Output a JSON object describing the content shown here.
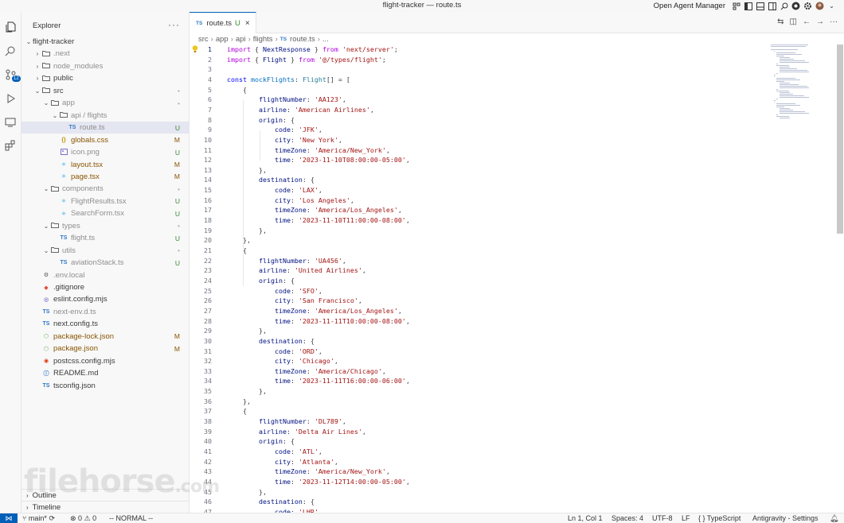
{
  "window": {
    "title": "flight-tracker — route.ts",
    "agent_manager": "Open Agent Manager"
  },
  "activity_bar": {
    "items": [
      "explorer-icon",
      "search-icon",
      "source-control-icon",
      "run-debug-icon",
      "remote-explorer-icon",
      "extensions-icon"
    ],
    "scm_badge": "12"
  },
  "sidebar": {
    "header": "Explorer",
    "more": "···",
    "tree": [
      {
        "label": "flight-tracker",
        "depth": 0,
        "chev": "⌄",
        "icon": "",
        "status": "",
        "cls": ""
      },
      {
        "label": ".next",
        "depth": 1,
        "chev": "›",
        "icon": "folder",
        "status": "",
        "cls": "c-ign"
      },
      {
        "label": "node_modules",
        "depth": 1,
        "chev": "›",
        "icon": "folder",
        "status": "",
        "cls": "c-ign"
      },
      {
        "label": "public",
        "depth": 1,
        "chev": "›",
        "icon": "folder",
        "status": "",
        "cls": ""
      },
      {
        "label": "src",
        "depth": 1,
        "chev": "⌄",
        "icon": "folder",
        "status": "•",
        "cls": ""
      },
      {
        "label": "app",
        "depth": 2,
        "chev": "⌄",
        "icon": "folder",
        "status": "•",
        "cls": "c-ign"
      },
      {
        "label": "api / flights",
        "depth": 3,
        "chev": "⌄",
        "icon": "folder",
        "status": "",
        "cls": "c-ign"
      },
      {
        "label": "route.ts",
        "depth": 4,
        "chev": "",
        "icon": "TS",
        "status": "U",
        "cls": "c-ign",
        "selected": true
      },
      {
        "label": "globals.css",
        "depth": 3,
        "chev": "",
        "icon": "{}",
        "status": "M",
        "cls": "c-mod"
      },
      {
        "label": "icon.png",
        "depth": 3,
        "chev": "",
        "icon": "img",
        "status": "U",
        "cls": "c-ign"
      },
      {
        "label": "layout.tsx",
        "depth": 3,
        "chev": "",
        "icon": "⚛",
        "status": "M",
        "cls": "c-mod"
      },
      {
        "label": "page.tsx",
        "depth": 3,
        "chev": "",
        "icon": "⚛",
        "status": "M",
        "cls": "c-mod"
      },
      {
        "label": "components",
        "depth": 2,
        "chev": "⌄",
        "icon": "folder",
        "status": "•",
        "cls": "c-ign"
      },
      {
        "label": "FlightResults.tsx",
        "depth": 3,
        "chev": "",
        "icon": "⚛",
        "status": "U",
        "cls": "c-ign"
      },
      {
        "label": "SearchForm.tsx",
        "depth": 3,
        "chev": "",
        "icon": "⚛",
        "status": "U",
        "cls": "c-ign"
      },
      {
        "label": "types",
        "depth": 2,
        "chev": "⌄",
        "icon": "folder",
        "status": "•",
        "cls": "c-ign"
      },
      {
        "label": "flight.ts",
        "depth": 3,
        "chev": "",
        "icon": "TS",
        "status": "U",
        "cls": "c-ign"
      },
      {
        "label": "utils",
        "depth": 2,
        "chev": "⌄",
        "icon": "folder",
        "status": "•",
        "cls": "c-ign"
      },
      {
        "label": "aviationStack.ts",
        "depth": 3,
        "chev": "",
        "icon": "TS",
        "status": "U",
        "cls": "c-ign"
      },
      {
        "label": ".env.local",
        "depth": 1,
        "chev": "",
        "icon": "⚙",
        "status": "",
        "cls": "c-ign"
      },
      {
        "label": ".gitignore",
        "depth": 1,
        "chev": "",
        "icon": "◆",
        "status": "",
        "cls": ""
      },
      {
        "label": "eslint.config.mjs",
        "depth": 1,
        "chev": "",
        "icon": "◎",
        "status": "",
        "cls": ""
      },
      {
        "label": "next-env.d.ts",
        "depth": 1,
        "chev": "",
        "icon": "TS",
        "status": "",
        "cls": "c-ign"
      },
      {
        "label": "next.config.ts",
        "depth": 1,
        "chev": "",
        "icon": "TS",
        "status": "",
        "cls": ""
      },
      {
        "label": "package-lock.json",
        "depth": 1,
        "chev": "",
        "icon": "⬡",
        "status": "M",
        "cls": "c-mod"
      },
      {
        "label": "package.json",
        "depth": 1,
        "chev": "",
        "icon": "⬡",
        "status": "M",
        "cls": "c-mod"
      },
      {
        "label": "postcss.config.mjs",
        "depth": 1,
        "chev": "",
        "icon": "◉",
        "status": "",
        "cls": ""
      },
      {
        "label": "README.md",
        "depth": 1,
        "chev": "",
        "icon": "ⓘ",
        "status": "",
        "cls": ""
      },
      {
        "label": "tsconfig.json",
        "depth": 1,
        "chev": "",
        "icon": "TS",
        "status": "",
        "cls": ""
      }
    ],
    "outline": "Outline",
    "timeline": "Timeline"
  },
  "editor": {
    "tab": {
      "icon": "TS",
      "label": "route.ts",
      "status": "U",
      "close": "×"
    },
    "breadcrumb": [
      "src",
      "app",
      "api",
      "flights",
      "route.ts",
      "..."
    ],
    "code": [
      "<span class='kw'>import</span> { <span class='p'>NextResponse</span> } <span class='kw'>from</span> <span class='s'>'next/server'</span>;",
      "<span class='kw'>import</span> { <span class='p'>Flight</span> } <span class='kw'>from</span> <span class='s'>'@/types/flight'</span>;",
      "",
      "<span class='k'>const</span> <span class='v'>mockFlights</span>: <span class='t'>Flight</span>[] = [",
      "    {",
      "        <span class='p'>flightNumber</span>: <span class='s'>'AA123'</span>,",
      "        <span class='p'>airline</span>: <span class='s'>'American Airlines'</span>,",
      "        <span class='p'>origin</span>: {",
      "            <span class='p'>code</span>: <span class='s'>'JFK'</span>,",
      "            <span class='p'>city</span>: <span class='s'>'New York'</span>,",
      "            <span class='p'>timeZone</span>: <span class='s'>'America/New_York'</span>,",
      "            <span class='p'>time</span>: <span class='s'>'2023-11-10T08:00:00-05:00'</span>,",
      "        },",
      "        <span class='p'>destination</span>: {",
      "            <span class='p'>code</span>: <span class='s'>'LAX'</span>,",
      "            <span class='p'>city</span>: <span class='s'>'Los Angeles'</span>,",
      "            <span class='p'>timeZone</span>: <span class='s'>'America/Los_Angeles'</span>,",
      "            <span class='p'>time</span>: <span class='s'>'2023-11-10T11:00:00-08:00'</span>,",
      "        },",
      "    },",
      "    {",
      "        <span class='p'>flightNumber</span>: <span class='s'>'UA456'</span>,",
      "        <span class='p'>airline</span>: <span class='s'>'United Airlines'</span>,",
      "        <span class='p'>origin</span>: {",
      "            <span class='p'>code</span>: <span class='s'>'SFO'</span>,",
      "            <span class='p'>city</span>: <span class='s'>'San Francisco'</span>,",
      "            <span class='p'>timeZone</span>: <span class='s'>'America/Los_Angeles'</span>,",
      "            <span class='p'>time</span>: <span class='s'>'2023-11-11T10:00:00-08:00'</span>,",
      "        },",
      "        <span class='p'>destination</span>: {",
      "            <span class='p'>code</span>: <span class='s'>'ORD'</span>,",
      "            <span class='p'>city</span>: <span class='s'>'Chicago'</span>,",
      "            <span class='p'>timeZone</span>: <span class='s'>'America/Chicago'</span>,",
      "            <span class='p'>time</span>: <span class='s'>'2023-11-11T16:00:00-06:00'</span>,",
      "        },",
      "    },",
      "    {",
      "        <span class='p'>flightNumber</span>: <span class='s'>'DL789'</span>,",
      "        <span class='p'>airline</span>: <span class='s'>'Delta Air Lines'</span>,",
      "        <span class='p'>origin</span>: {",
      "            <span class='p'>code</span>: <span class='s'>'ATL'</span>,",
      "            <span class='p'>city</span>: <span class='s'>'Atlanta'</span>,",
      "            <span class='p'>timeZone</span>: <span class='s'>'America/New_York'</span>,",
      "            <span class='p'>time</span>: <span class='s'>'2023-11-12T14:00:00-05:00'</span>,",
      "        },",
      "        <span class='p'>destination</span>: {",
      "            <span class='p'>code</span>: <span class='s'>'LHR'</span>,"
    ]
  },
  "status_bar": {
    "branch": "main*",
    "problems": "⊗ 0 ⚠ 0",
    "mode": "-- NORMAL --",
    "position": "Ln 1, Col 1",
    "spaces": "Spaces: 4",
    "encoding": "UTF-8",
    "eol": "LF",
    "language": "{ } TypeScript",
    "settings": "Antigravity - Settings"
  },
  "watermark": {
    "main": "filehorse",
    "suffix": ".com"
  }
}
